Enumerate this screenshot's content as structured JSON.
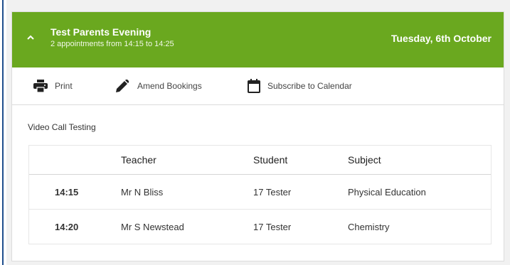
{
  "header": {
    "title": "Test Parents Evening",
    "subtitle": "2 appointments from 14:15 to 14:25",
    "date": "Tuesday, 6th October",
    "color": "#6aa81f"
  },
  "toolbar": {
    "print_label": "Print",
    "amend_label": "Amend Bookings",
    "subscribe_label": "Subscribe to Calendar",
    "icons": [
      "printer-icon",
      "pencil-icon",
      "calendar-icon"
    ]
  },
  "section": {
    "label": "Video Call Testing"
  },
  "table": {
    "headers": [
      "",
      "Teacher",
      "Student",
      "Subject"
    ],
    "rows": [
      {
        "time": "14:15",
        "teacher": "Mr N Bliss",
        "student": "17 Tester",
        "subject": "Physical Education"
      },
      {
        "time": "14:20",
        "teacher": "Mr S Newstead",
        "student": "17 Tester",
        "subject": "Chemistry"
      }
    ]
  }
}
